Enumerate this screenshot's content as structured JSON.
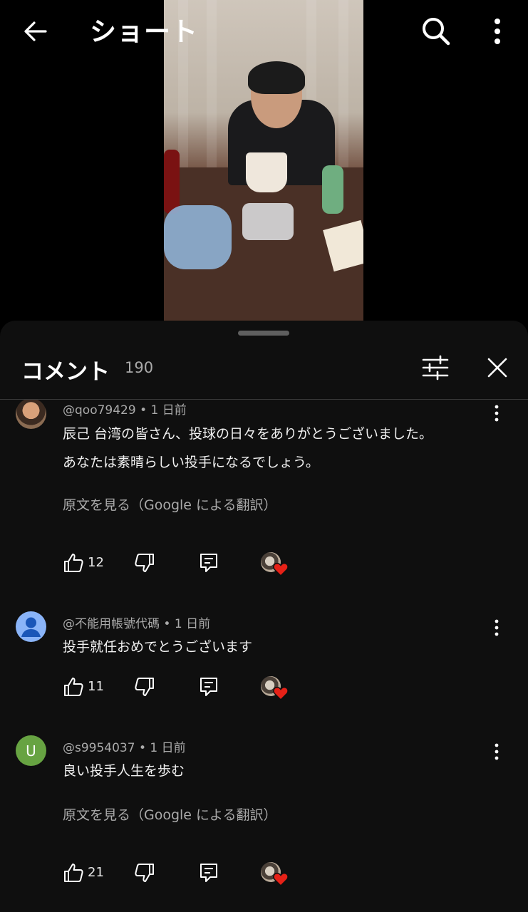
{
  "header": {
    "title": "ショート"
  },
  "sheet": {
    "title": "コメント",
    "count": "190"
  },
  "comments": [
    {
      "author": "@qoo79429",
      "time": "1 日前",
      "text_lines": [
        "辰己 台湾の皆さん、投球の日々をありがとうございました。",
        "あなたは素晴らしい投手になるでしょう。"
      ],
      "translate_link": "原文を見る（Google による翻訳）",
      "likes": "12",
      "avatar": "photo"
    },
    {
      "author": "@不能用帳號代碼",
      "time": "1 日前",
      "text_lines": [
        "投手就任おめでとうございます"
      ],
      "likes": "11",
      "avatar": "default-person"
    },
    {
      "author": "@s9954037",
      "time": "1 日前",
      "text_lines": [
        "良い投手人生を歩む"
      ],
      "translate_link": "原文を見る（Google による翻訳）",
      "likes": "21",
      "avatar_letter": "U"
    }
  ],
  "colors": {
    "background": "#000000",
    "sheet": "#0f0f0f",
    "secondary_text": "#aaaaaa",
    "heart": "#e62117",
    "avatar_green": "#67a342",
    "avatar_blue": "#8ab4f8"
  },
  "icons": [
    "back-arrow-icon",
    "search-icon",
    "more-vert-icon",
    "filter-icon",
    "close-icon",
    "thumb-up-icon",
    "thumb-down-icon",
    "reply-icon",
    "heart-icon"
  ]
}
